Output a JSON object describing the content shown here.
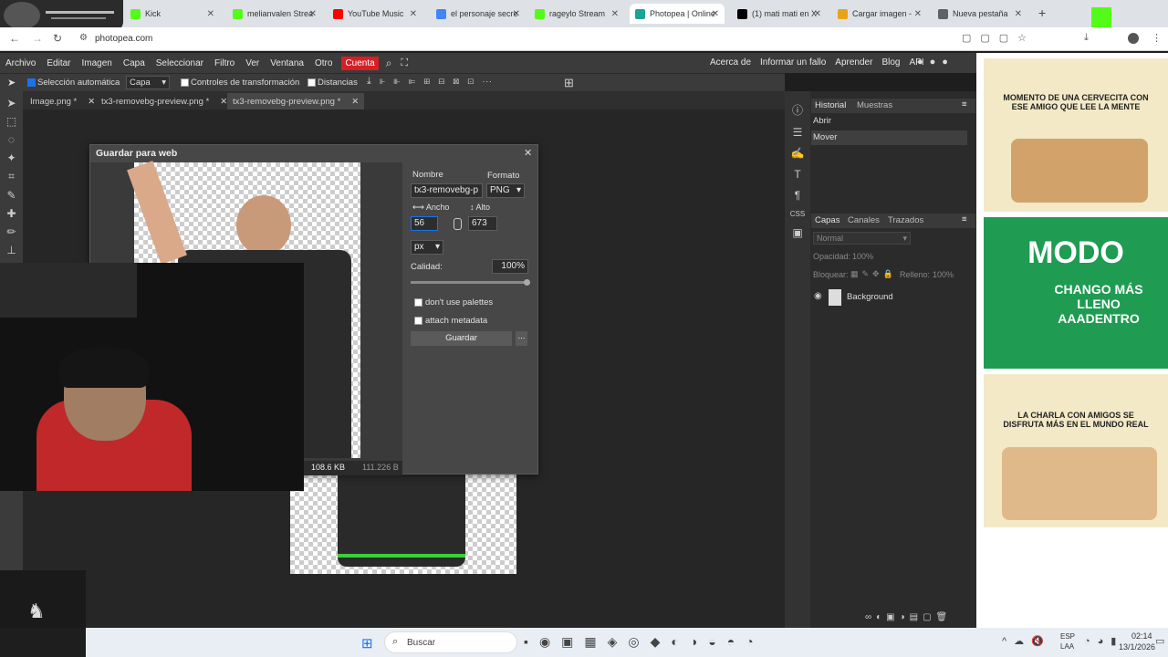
{
  "browser": {
    "tabs": [
      {
        "label": "Kick",
        "favicon_color": "#53fc18"
      },
      {
        "label": "melianvalen Strea",
        "favicon_color": "#53fc18"
      },
      {
        "label": "YouTube Music",
        "favicon_color": "#ff0000"
      },
      {
        "label": "el personaje secre",
        "favicon_color": "#4285f4"
      },
      {
        "label": "rageylo Stream",
        "favicon_color": "#53fc18"
      },
      {
        "label": "Photopea | Online",
        "favicon_color": "#18a497"
      },
      {
        "label": "(1) mati mati en X",
        "favicon_color": "#000000"
      },
      {
        "label": "Cargar imagen -",
        "favicon_color": "#e8a317"
      },
      {
        "label": "Nueva pestaña",
        "favicon_color": "#5f6368"
      }
    ],
    "active_tab_index": 5,
    "url": "photopea.com"
  },
  "menubar": {
    "items": [
      "Archivo",
      "Editar",
      "Imagen",
      "Capa",
      "Seleccionar",
      "Filtro",
      "Ver",
      "Ventana",
      "Otro"
    ],
    "cuenta_label": "Cuenta",
    "right_links": [
      "Acerca de",
      "Informar un fallo",
      "Aprender",
      "Blog",
      "API"
    ]
  },
  "options": {
    "auto_select_label": "Selección automática",
    "layer_select_value": "Capa",
    "transform_controls_label": "Controles de transformación",
    "distances_label": "Distancias"
  },
  "doc_tabs": [
    "Image.png *",
    "tx3-removebg-preview.png *",
    "tx3-removebg-preview.png *"
  ],
  "dialog": {
    "title": "Guardar para web",
    "name_label": "Nombre",
    "name_value": "tx3-removebg-p",
    "format_label": "Formato",
    "format_value": "PNG",
    "width_label": "⟷ Ancho",
    "width_value": "56",
    "height_label": "↕ Alto",
    "height_value": "673",
    "unit_value": "px",
    "quality_label": "Calidad:",
    "quality_value": "100%",
    "quality_fraction": 1.0,
    "palettes_label": "don't use palettes",
    "metadata_label": "attach metadata",
    "save_label": "Guardar",
    "more_label": "...",
    "size_kb": "108.6 KB",
    "size_bytes": "111.226 B"
  },
  "history_panel": {
    "tabs": [
      "Historial",
      "Muestras"
    ],
    "items": [
      "Abrir",
      "Mover"
    ]
  },
  "layers_panel": {
    "tabs": [
      "Capas",
      "Canales",
      "Trazados"
    ],
    "blend_mode": "Normal",
    "opacity_label": "Opacidad:",
    "opacity_value": "100%",
    "lock_label": "Bloquear:",
    "fill_label": "Relleno:",
    "fill_value": "100%",
    "layers": [
      "Background"
    ]
  },
  "ads": [
    {
      "text": "MOMENTO DE UNA CERVECITA CON ESE AMIGO QUE LEE LA MENTE",
      "bg": "#f3e9c6"
    },
    {
      "text": "MODO",
      "subtext": "CHANGO MÁS LLENO AAADENTRO",
      "bg": "#1f9c52"
    },
    {
      "text": "LA CHARLA CON AMIGOS SE DISFRUTA MÁS EN EL MUNDO REAL",
      "bg": "#f3e9c6"
    }
  ],
  "taskbar": {
    "search_placeholder": "Buscar",
    "lang": "ESP",
    "lang2": "LAA",
    "time": "02:14",
    "date": "13/1/2026"
  }
}
